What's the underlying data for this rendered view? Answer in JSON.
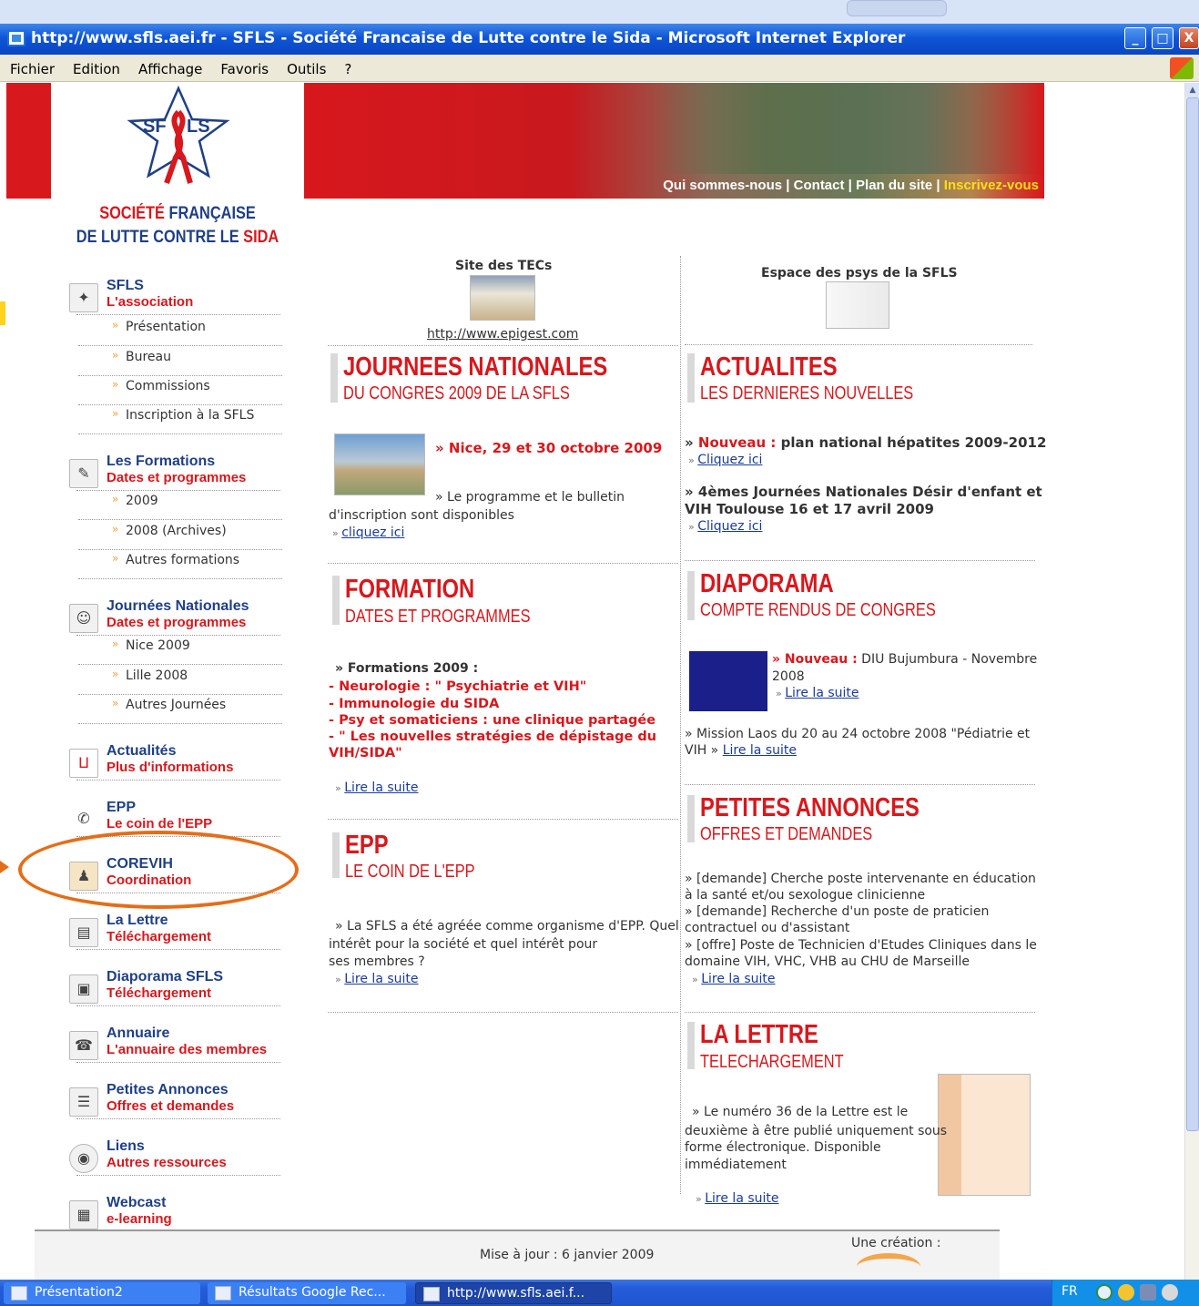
{
  "window": {
    "title": "http://www.sfls.aei.fr - SFLS - Société Francaise de Lutte contre le Sida - Microsoft Internet Explorer",
    "controls": [
      "_",
      "□",
      "X"
    ]
  },
  "menubar": [
    "Fichier",
    "Edition",
    "Affichage",
    "Favoris",
    "Outils",
    "?"
  ],
  "logo": {
    "line1a": "SOCIÉTÉ ",
    "line1b": "FRANÇAISE",
    "line2a": "DE ",
    "line2b": "LUTTE CONTRE LE ",
    "line2c": "SIDA",
    "star_left": "SF",
    "star_right": "LS"
  },
  "banner": {
    "links": [
      "Qui sommes-nous",
      "Contact",
      "Plan du site"
    ],
    "highlight": "Inscrivez-vous",
    "sep": "|"
  },
  "sidebar": {
    "sfls": {
      "t1": "SFLS",
      "t2": "L'association",
      "subs": [
        "Présentation",
        "Bureau",
        "Commissions",
        "Inscription à la SFLS"
      ]
    },
    "formations": {
      "t1": "Les Formations",
      "t2": "Dates et programmes",
      "subs": [
        "2009",
        "2008 (Archives)",
        "Autres formations"
      ]
    },
    "journees": {
      "t1": "Journées Nationales",
      "t2": "Dates et programmes",
      "subs": [
        "Nice 2009",
        "Lille 2008",
        "Autres Journées"
      ]
    },
    "actualites": {
      "t1": "Actualités",
      "t2": "Plus d'informations"
    },
    "epp": {
      "t1": "EPP",
      "t2": "Le coin de l'EPP"
    },
    "corevih": {
      "t1": "COREVIH",
      "t2": "Coordination"
    },
    "lettre": {
      "t1": "La Lettre",
      "t2": "Téléchargement"
    },
    "diaporama": {
      "t1": "Diaporama SFLS",
      "t2": "Téléchargement"
    },
    "annuaire": {
      "t1": "Annuaire",
      "t2": "L'annuaire des membres"
    },
    "annonces": {
      "t1": "Petites Annonces",
      "t2": "Offres et demandes"
    },
    "liens": {
      "t1": "Liens",
      "t2": "Autres ressources"
    },
    "webcast": {
      "t1": "Webcast",
      "t2": "e-learning"
    }
  },
  "tec": {
    "title": "Site des TECs",
    "url": "http://www.epigest.com"
  },
  "psys": {
    "title": "Espace des psys de la SFLS"
  },
  "journees_nat": {
    "title": "JOURNEES NATIONALES",
    "subtitle": "DU CONGRES 2009 DE LA SFLS",
    "headline": "» Nice, 29 et 30 octobre 2009",
    "text1": "» Le programme et le bulletin",
    "text2": "d'inscription sont disponibles",
    "link": "cliquez ici"
  },
  "actualites": {
    "title": "ACTUALITES",
    "subtitle": "LES DERNIERES NOUVELLES",
    "n1_new": "Nouveau :",
    "n1_text": " plan national hépatites 2009-2012",
    "n1_link": "Cliquez ici",
    "n2_line1": "» 4èmes Journées Nationales Désir d'enfant et",
    "n2_line2": "VIH Toulouse 16 et 17 avril 2009",
    "n2_link": "Cliquez ici"
  },
  "formation": {
    "title": "FORMATION",
    "subtitle": "DATES ET PROGRAMMES",
    "heading": "» Formations 2009 :",
    "items": [
      "- Neurologie : \" Psychiatrie et VIH\"",
      "- Immunologie du SIDA",
      "- Psy et somaticiens : une clinique partagée",
      "- \" Les nouvelles stratégies de dépistage du",
      "VIH/SIDA\""
    ],
    "link": "Lire la suite"
  },
  "diaporama": {
    "title": "DIAPORAMA",
    "subtitle": "COMPTE RENDUS DE CONGRES",
    "new": "» Nouveau :",
    "text_a": " DIU Bujumbura - Novembre",
    "text_b": "2008",
    "link1": "Lire la suite",
    "mission_a": "» Mission Laos du 20 au 24 octobre 2008 \"Pédiatrie et",
    "mission_b": "VIH »",
    "link2": "Lire la suite"
  },
  "epp": {
    "title": "EPP",
    "subtitle": "LE COIN DE L'EPP",
    "text1": "» La SFLS a été agréée comme organisme d'EPP. Quel",
    "text2": "intérêt pour la société et quel intérêt pour",
    "text3": "ses membres ?",
    "link": "Lire la suite"
  },
  "annonces": {
    "title": "PETITES ANNONCES",
    "subtitle": "OFFRES ET DEMANDES",
    "lines": [
      "» [demande] Cherche poste intervenante en éducation",
      "à la santé et/ou sexologue clinicienne",
      "» [demande] Recherche d'un poste de praticien",
      "contractuel ou d'assistant",
      "» [offre] Poste de Technicien d'Etudes Cliniques dans le",
      "domaine VIH, VHC, VHB au CHU de Marseille"
    ],
    "link": "Lire la suite"
  },
  "lettre": {
    "title": "LA LETTRE",
    "subtitle": "TELECHARGEMENT",
    "lines": [
      "» Le numéro 36 de la Lettre est le",
      "deuxième à être publié uniquement sous",
      "forme électronique. Disponible",
      "immédiatement"
    ],
    "link": "Lire la suite"
  },
  "footer": {
    "maj": "Mise à jour : 6 janvier 2009",
    "creation": "Une création :"
  },
  "taskbar": {
    "tasks": [
      "Présentation2",
      "Résultats Google Rec...",
      "http://www.sfls.aei.f..."
    ],
    "lang": "FR"
  }
}
